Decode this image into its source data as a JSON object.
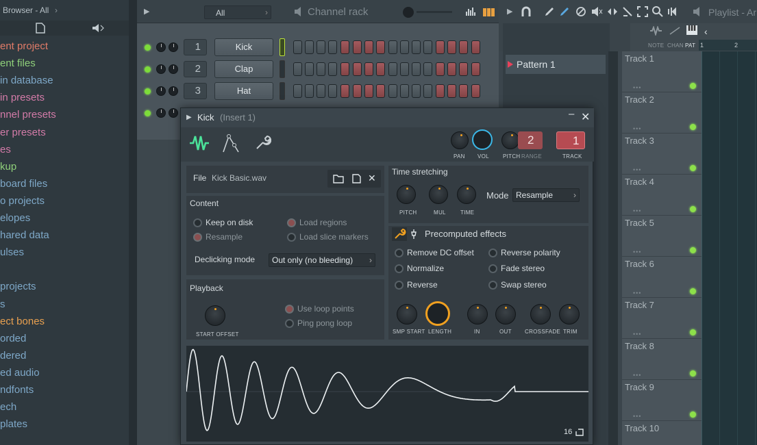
{
  "browser": {
    "title": "Browser - All",
    "items": [
      {
        "label": "ent project",
        "color": "#e07b68"
      },
      {
        "label": "ent files",
        "color": "#8fd07a"
      },
      {
        "label": "in database",
        "color": "#7ea8c8"
      },
      {
        "label": "in presets",
        "color": "#d37ba8"
      },
      {
        "label": "nnel presets",
        "color": "#d37ba8"
      },
      {
        "label": "er presets",
        "color": "#d37ba8"
      },
      {
        "label": "es",
        "color": "#d37ba8"
      },
      {
        "label": "kup",
        "color": "#8fd07a"
      },
      {
        "label": "board files",
        "color": "#7ea8c8"
      },
      {
        "label": "o projects",
        "color": "#7ea8c8"
      },
      {
        "label": "elopes",
        "color": "#7ea8c8"
      },
      {
        "label": "hared data",
        "color": "#7ea8c8"
      },
      {
        "label": "ulses",
        "color": "#7ea8c8"
      },
      {
        "label": "",
        "color": "#7ea8c8"
      },
      {
        "label": "projects",
        "color": "#7ea8c8"
      },
      {
        "label": "s",
        "color": "#7ea8c8"
      },
      {
        "label": "ect bones",
        "color": "#e8a050"
      },
      {
        "label": "orded",
        "color": "#7ea8c8"
      },
      {
        "label": "dered",
        "color": "#7ea8c8"
      },
      {
        "label": "ed audio",
        "color": "#7ea8c8"
      },
      {
        "label": "ndfonts",
        "color": "#7ea8c8"
      },
      {
        "label": "ech",
        "color": "#7ea8c8"
      },
      {
        "label": "plates",
        "color": "#7ea8c8"
      }
    ]
  },
  "channel_rack": {
    "filter": "All",
    "title": "Channel rack",
    "channels": [
      {
        "num": "1",
        "name": "Kick"
      },
      {
        "num": "2",
        "name": "Clap"
      },
      {
        "num": "3",
        "name": "Hat"
      }
    ],
    "step_pattern": "gggg rrrr gggg rrrr"
  },
  "playlist": {
    "title": "Playlist - Ar",
    "header_labels": {
      "note": "NOTE",
      "chan": "CHAN",
      "pat": "PAT"
    },
    "ruler": [
      "1",
      "2"
    ],
    "pattern": "Pattern 1",
    "tracks": [
      "Track 1",
      "Track 2",
      "Track 3",
      "Track 4",
      "Track 5",
      "Track 6",
      "Track 7",
      "Track 8",
      "Track 9",
      "Track 10"
    ]
  },
  "sampler": {
    "title": "Kick",
    "insert": "(Insert 1)",
    "knobs": {
      "pan": "PAN",
      "vol": "VOL",
      "pitch": "PITCH",
      "range": "RANGE",
      "track": "TRACK"
    },
    "range_value": "2",
    "track_value": "1",
    "file_label": "File",
    "file_name": "Kick Basic.wav",
    "content_label": "Content",
    "keep_on_disk": "Keep on disk",
    "resample": "Resample",
    "load_regions": "Load regions",
    "load_slice_markers": "Load slice markers",
    "declicking_label": "Declicking mode",
    "declicking_value": "Out only (no bleeding)",
    "playback_label": "Playback",
    "start_offset": "START OFFSET",
    "use_loop_points": "Use loop points",
    "ping_pong_loop": "Ping pong loop",
    "time_stretching_label": "Time stretching",
    "ts_knobs": [
      "PITCH",
      "MUL",
      "TIME"
    ],
    "mode_label": "Mode",
    "mode_value": "Resample",
    "precomputed_label": "Precomputed effects",
    "effects_left": [
      "Remove DC offset",
      "Normalize",
      "Reverse"
    ],
    "effects_right": [
      "Reverse polarity",
      "Fade stereo",
      "Swap stereo"
    ],
    "effect_knobs": [
      "SMP START",
      "LENGTH",
      "IN",
      "OUT",
      "CROSSFADE",
      "TRIM"
    ],
    "bits": "16"
  },
  "colors": {
    "accent": "#f0a020",
    "led": "#7ddc3a",
    "step_red": "#a45a5e",
    "vol_ring": "#3bb8e8"
  }
}
